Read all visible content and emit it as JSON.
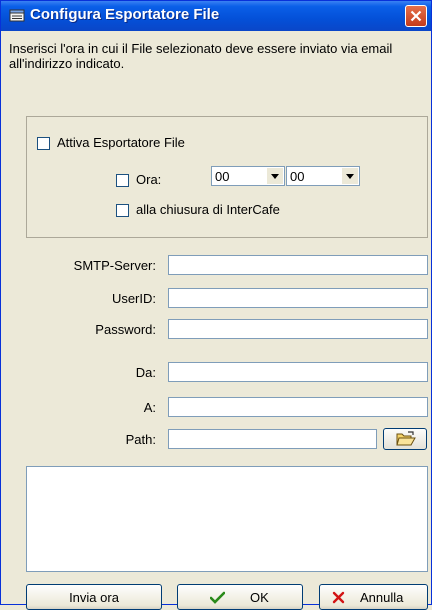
{
  "window": {
    "title": "Configura Esportatore File",
    "title_icon": "window-icon",
    "close_icon": "close-icon"
  },
  "intro": {
    "text": "Inserisci l'ora in cui il File selezionato deve essere inviato via email all'indirizzo indicato."
  },
  "exporter": {
    "enable_label": "Attiva Esportatore File",
    "enable_checked": false,
    "time_label": "Ora:",
    "time_checked": false,
    "hour_value": "00",
    "minute_value": "00",
    "on_close_label": "alla chiusura di InterCafe",
    "on_close_checked": false
  },
  "form": {
    "smtp_label": "SMTP-Server:",
    "smtp_value": "",
    "userid_label": "UserID:",
    "userid_value": "",
    "password_label": "Password:",
    "password_value": "",
    "from_label": "Da:",
    "from_value": "",
    "to_label": "A:",
    "to_value": "",
    "path_label": "Path:",
    "path_value": "",
    "browse_icon": "folder-open-icon"
  },
  "log": {
    "text": ""
  },
  "buttons": {
    "send_now": "Invia ora",
    "ok": "OK",
    "cancel": "Annulla",
    "ok_icon": "checkmark-icon",
    "cancel_icon": "x-icon"
  },
  "colors": {
    "titlebar": "#0450d8",
    "window_bg": "#ece9d8",
    "close_button": "#c43b1c",
    "ok_check": "#2a8a1a",
    "cancel_x": "#d21414"
  }
}
